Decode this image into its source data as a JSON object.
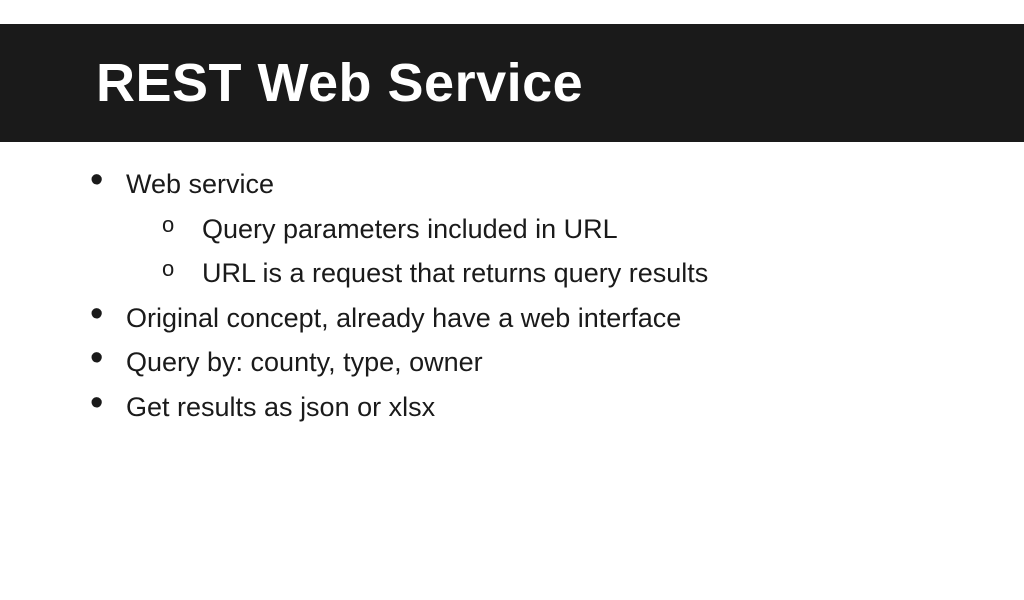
{
  "title": "REST Web Service",
  "bullets": [
    {
      "text": "Web service",
      "sub": [
        "Query parameters included in URL",
        "URL is a request that returns query results"
      ]
    },
    {
      "text": "Original concept, already have a web interface"
    },
    {
      "text": "Query by: county, type, owner"
    },
    {
      "text": "Get results as json or xlsx"
    }
  ]
}
